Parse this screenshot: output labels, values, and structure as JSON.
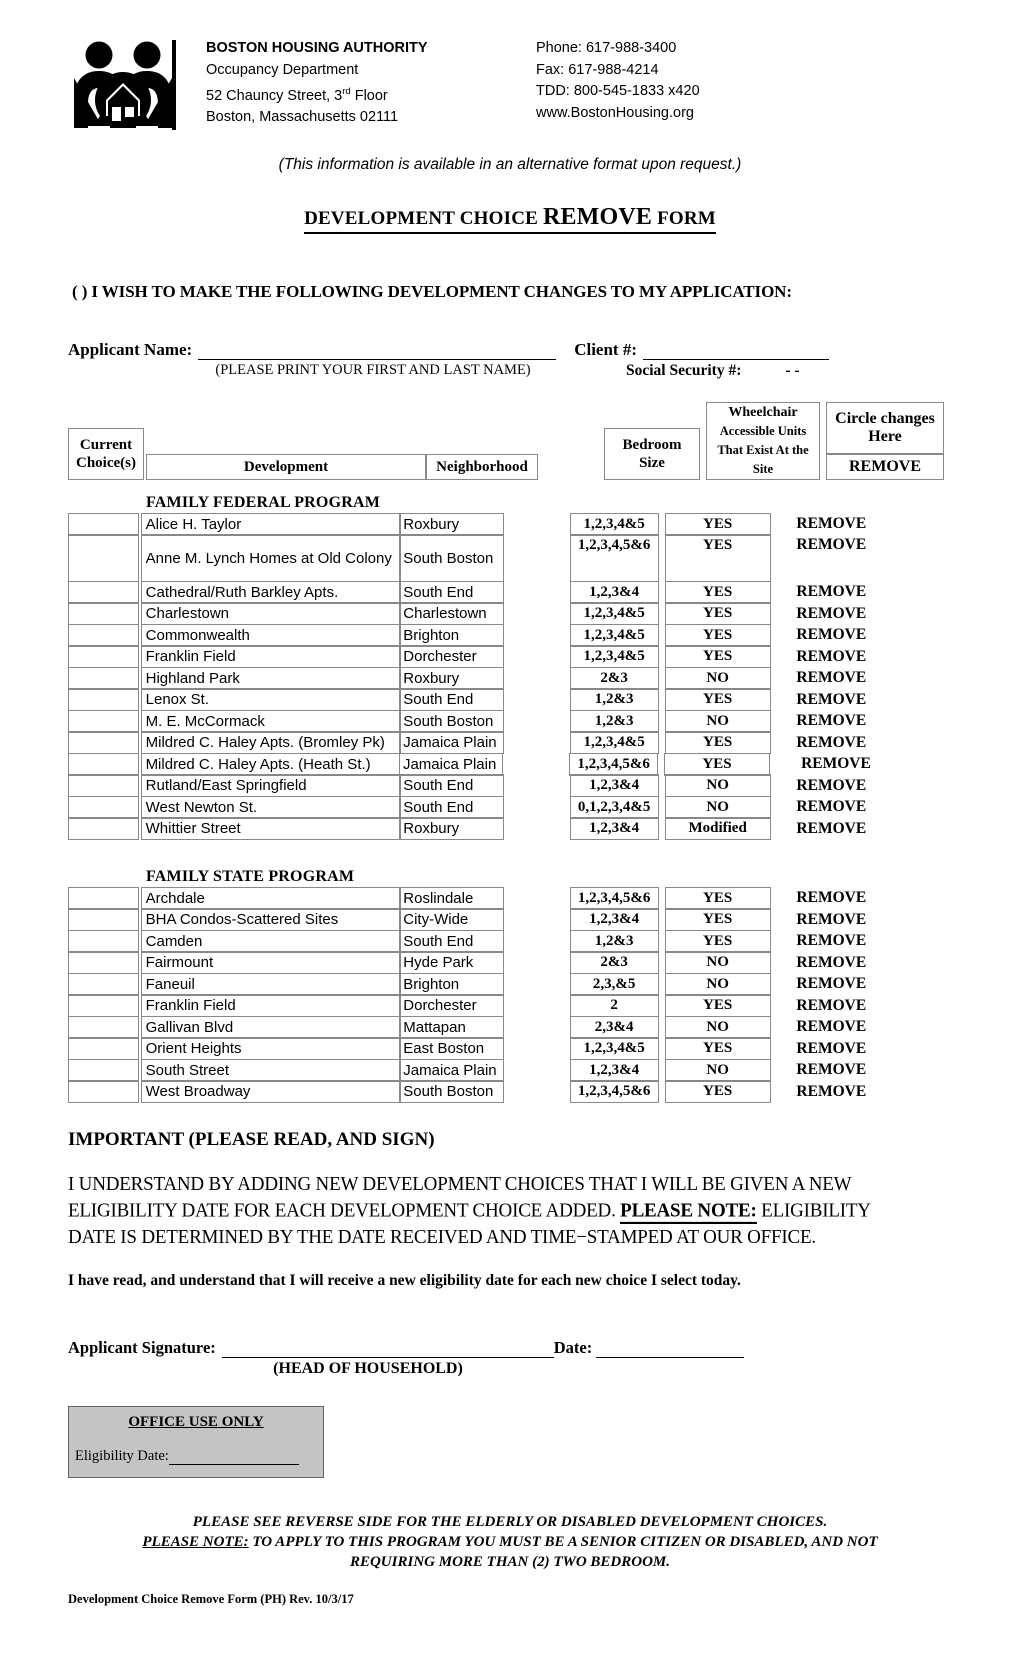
{
  "letterhead": {
    "org": "BOSTON HOUSING AUTHORITY",
    "dept": "Occupancy Department",
    "street_pre": "52 Chauncy Street, 3",
    "street_sup": "rd",
    "street_post": " Floor",
    "city": "Boston, Massachusetts 02111",
    "phone": "Phone: 617-988-3400",
    "fax": "Fax: 617-988-4214",
    "tdd": "TDD: 800-545-1833 x420",
    "web": "www.BostonHousing.org"
  },
  "alt_format_note": "(This information is available in an alternative format upon request.)",
  "title": {
    "part1": "DEVELOPMENT CHOICE ",
    "part2": "REMOVE",
    "part3": " FORM"
  },
  "wish_line": "(    ) I WISH TO MAKE THE FOLLOWING DEVELOPMENT CHANGES TO MY APPLICATION:",
  "applicant": {
    "name_label": "Applicant Name:",
    "client_label": "Client #:",
    "print_hint": "(PLEASE PRINT YOUR FIRST AND LAST NAME)",
    "ssn_label": "Social Security #:",
    "ssn_value": "-          -"
  },
  "table_header": {
    "current_line1": "Current",
    "current_line2": "Choice(s)",
    "development": "Development",
    "neighborhood": "Neighborhood",
    "bedroom_line1": "Bedroom",
    "bedroom_line2": "Size",
    "wheelchair_line1": "Wheelchair",
    "wheelchair_line2": "Accessible Units",
    "wheelchair_line3": "That Exist At the",
    "wheelchair_line4": "Site",
    "circle_line1": "Circle changes",
    "circle_line2": "Here",
    "remove": "REMOVE"
  },
  "programs": [
    {
      "name": "FAMILY FEDERAL PROGRAM",
      "rows": [
        {
          "development": "Alice H. Taylor",
          "neighborhood": "Roxbury",
          "bedroom": "1,2,3,4&5",
          "accessible": "YES",
          "action": "REMOVE"
        },
        {
          "development": "Anne M. Lynch Homes at Old Colony",
          "neighborhood": "South Boston",
          "bedroom": "1,2,3,4,5&6",
          "accessible": "YES",
          "action": "REMOVE",
          "tall": true
        },
        {
          "development": "Cathedral/Ruth Barkley Apts.",
          "neighborhood": "South End",
          "bedroom": "1,2,3&4",
          "accessible": "YES",
          "action": "REMOVE"
        },
        {
          "development": "Charlestown",
          "neighborhood": "Charlestown",
          "bedroom": "1,2,3,4&5",
          "accessible": "YES",
          "action": "REMOVE"
        },
        {
          "development": "Commonwealth",
          "neighborhood": "Brighton",
          "bedroom": "1,2,3,4&5",
          "accessible": "YES",
          "action": "REMOVE"
        },
        {
          "development": "Franklin Field",
          "neighborhood": "Dorchester",
          "bedroom": "1,2,3,4&5",
          "accessible": "YES",
          "action": "REMOVE"
        },
        {
          "development": "Highland Park",
          "neighborhood": "Roxbury",
          "bedroom": "2&3",
          "accessible": "NO",
          "action": "REMOVE"
        },
        {
          "development": "Lenox St.",
          "neighborhood": "South End",
          "bedroom": "1,2&3",
          "accessible": "YES",
          "action": "REMOVE"
        },
        {
          "development": "M. E. McCormack",
          "neighborhood": "South Boston",
          "bedroom": "1,2&3",
          "accessible": "NO",
          "action": "REMOVE"
        },
        {
          "development": "Mildred C. Haley Apts. (Bromley Pk)",
          "neighborhood": "Jamaica Plain",
          "bedroom": "1,2,3,4&5",
          "accessible": "YES",
          "action": "REMOVE"
        },
        {
          "development": "Mildred C. Haley Apts. (Heath St.)",
          "neighborhood": "Jamaica Plain",
          "bedroom": "1,2,3,4,5&6",
          "accessible": "YES",
          "action": "REMOVE",
          "indent": true
        },
        {
          "development": "Rutland/East Springfield",
          "neighborhood": "South End",
          "bedroom": "1,2,3&4",
          "accessible": "NO",
          "action": "REMOVE"
        },
        {
          "development": "West Newton St.",
          "neighborhood": "South End",
          "bedroom": "0,1,2,3,4&5",
          "accessible": "NO",
          "action": "REMOVE"
        },
        {
          "development": "Whittier Street",
          "neighborhood": "Roxbury",
          "bedroom": "1,2,3&4",
          "accessible": "Modified",
          "action": "REMOVE"
        }
      ]
    },
    {
      "name": "FAMILY STATE PROGRAM",
      "rows": [
        {
          "development": "Archdale",
          "neighborhood": "Roslindale",
          "bedroom": "1,2,3,4,5&6",
          "accessible": "YES",
          "action": "REMOVE"
        },
        {
          "development": "BHA Condos-Scattered Sites",
          "neighborhood": "City-Wide",
          "bedroom": "1,2,3&4",
          "accessible": "YES",
          "action": "REMOVE"
        },
        {
          "development": "Camden",
          "neighborhood": "South End",
          "bedroom": "1,2&3",
          "accessible": "YES",
          "action": "REMOVE"
        },
        {
          "development": "Fairmount",
          "neighborhood": "Hyde Park",
          "bedroom": "2&3",
          "accessible": "NO",
          "action": "REMOVE"
        },
        {
          "development": "Faneuil",
          "neighborhood": "Brighton",
          "bedroom": "2,3,&5",
          "accessible": "NO",
          "action": "REMOVE"
        },
        {
          "development": "Franklin Field",
          "neighborhood": "Dorchester",
          "bedroom": "2",
          "accessible": "YES",
          "action": "REMOVE"
        },
        {
          "development": "Gallivan Blvd",
          "neighborhood": "Mattapan",
          "bedroom": "2,3&4",
          "accessible": "NO",
          "action": "REMOVE"
        },
        {
          "development": "Orient Heights",
          "neighborhood": "East Boston",
          "bedroom": "1,2,3,4&5",
          "accessible": "YES",
          "action": "REMOVE"
        },
        {
          "development": "South Street",
          "neighborhood": "Jamaica Plain",
          "bedroom": "1,2,3&4",
          "accessible": "NO",
          "action": "REMOVE"
        },
        {
          "development": "West Broadway",
          "neighborhood": "South Boston",
          "bedroom": "1,2,3,4,5&6",
          "accessible": "YES",
          "action": "REMOVE"
        }
      ]
    }
  ],
  "important": {
    "heading": "IMPORTANT (PLEASE READ, AND SIGN)",
    "para_part1": "I UNDERSTAND BY ADDING NEW DEVELOPMENT CHOICES THAT I WILL BE GIVEN A NEW ELIGIBILITY DATE FOR EACH DEVELOPMENT CHOICE ADDED.  ",
    "para_note": "PLEASE NOTE:",
    "para_part2": " ELIGIBILITY DATE IS DETERMINED BY THE DATE RECEIVED AND TIME−STAMPED AT OUR OFFICE.",
    "read_line": "I have read, and understand that I will receive a new eligibility date for each new choice I select today."
  },
  "signature": {
    "label": "Applicant Signature:",
    "date_label": "Date:",
    "head_of_household": "(HEAD OF HOUSEHOLD)"
  },
  "office_use": {
    "title": "OFFICE USE ONLY",
    "eligibility_label": "Eligibility Date:"
  },
  "footer": {
    "reverse_line1": "PLEASE SEE REVERSE SIDE FOR THE ELDERLY OR DISABLED DEVELOPMENT CHOICES.",
    "reverse_note": "PLEASE NOTE:",
    "reverse_line2": " TO APPLY TO THIS PROGRAM YOU MUST BE A SENIOR CITIZEN OR DISABLED, AND NOT",
    "reverse_line3": "REQUIRING MORE THAN (2) TWO BEDROOM.",
    "form_rev": "Development Choice Remove Form (PH) Rev. 10/3/17"
  }
}
